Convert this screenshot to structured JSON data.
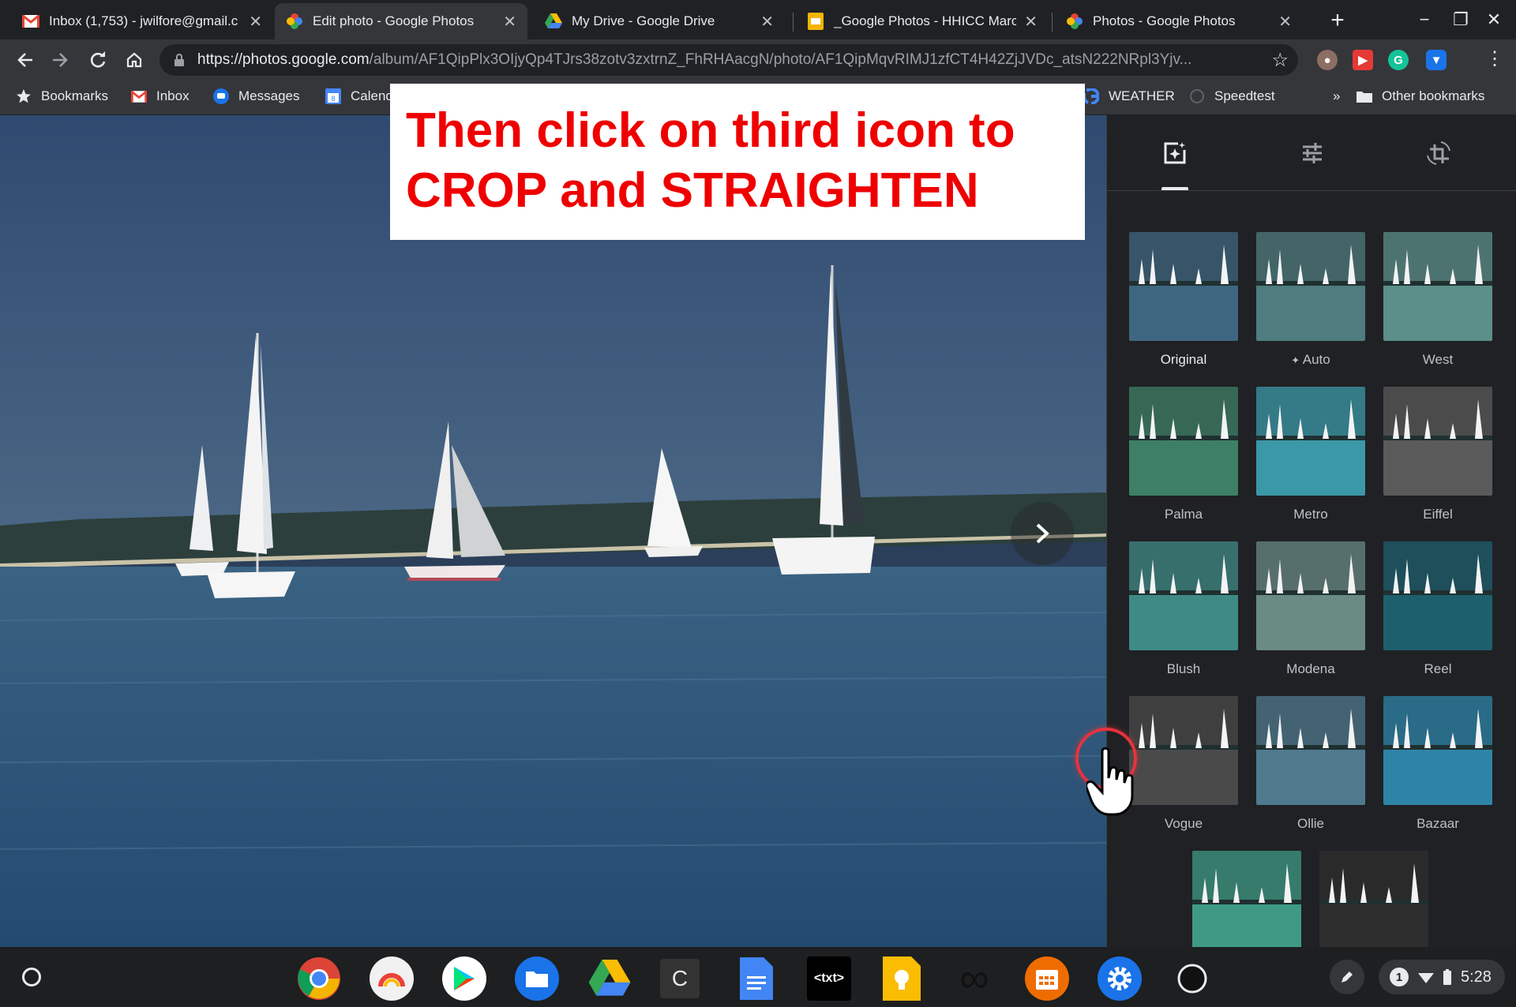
{
  "browser": {
    "tabs": [
      {
        "title": "Inbox (1,753) - jwilfore@gmail.c",
        "icon": "gmail-icon",
        "active": false
      },
      {
        "title": "Edit photo - Google Photos",
        "icon": "google-photos-icon",
        "active": true
      },
      {
        "title": "My Drive - Google Drive",
        "icon": "google-drive-icon",
        "active": false
      },
      {
        "title": "_Google Photos - HHICC March",
        "icon": "google-slides-icon",
        "active": false
      },
      {
        "title": "Photos - Google Photos",
        "icon": "google-photos-icon",
        "active": false
      }
    ],
    "url_host": "https://photos.google.com",
    "url_path": "/album/AF1QipPlx3OIjyQp4TJrs38zotv3zxtrnZ_FhRHAacgN/photo/AF1QipMqvRIMJ1zfCT4H42ZjJVDc_atsN222NRpl3Yjv...",
    "bookmarks": [
      {
        "label": "Bookmarks",
        "icon": "star-icon"
      },
      {
        "label": "Inbox",
        "icon": "gmail-icon"
      },
      {
        "label": "Messages",
        "icon": "messages-icon"
      },
      {
        "label": "Calend",
        "icon": "calendar-icon"
      },
      {
        "label": "WEATHER",
        "icon": "google-icon"
      },
      {
        "label": "Speedtest",
        "icon": "speedtest-icon"
      },
      {
        "label": "»",
        "icon": ""
      },
      {
        "label": "Other bookmarks",
        "icon": "folder-icon"
      }
    ]
  },
  "annotation": {
    "line1": "Then click on third icon to",
    "line2": "CROP and STRAIGHTEN"
  },
  "editor": {
    "tabs": [
      {
        "name": "filters",
        "icon": "photo-filter-icon",
        "active": true
      },
      {
        "name": "adjustments",
        "icon": "tune-sliders-icon",
        "active": false
      },
      {
        "name": "crop-rotate",
        "icon": "crop-rotate-icon",
        "active": false
      }
    ],
    "filters": [
      {
        "label": "Original",
        "selected": true,
        "tint": "#3f6680"
      },
      {
        "label": "Auto",
        "selected": false,
        "tint": "#4f7c7e"
      },
      {
        "label": "West",
        "selected": false,
        "tint": "#5c8f8a"
      },
      {
        "label": "Palma",
        "selected": false,
        "tint": "#3d8066"
      },
      {
        "label": "Metro",
        "selected": false,
        "tint": "#3b98a8"
      },
      {
        "label": "Eiffel",
        "selected": false,
        "tint": "#5a5a5a"
      },
      {
        "label": "Blush",
        "selected": false,
        "tint": "#3f8a84"
      },
      {
        "label": "Modena",
        "selected": false,
        "tint": "#6a8a84"
      },
      {
        "label": "Reel",
        "selected": false,
        "tint": "#1e5f6e"
      },
      {
        "label": "Vogue",
        "selected": false,
        "tint": "#4a4a4a"
      },
      {
        "label": "Ollie",
        "selected": false,
        "tint": "#4f7a8e"
      },
      {
        "label": "Bazaar",
        "selected": false,
        "tint": "#2d84a8"
      },
      {
        "label": "",
        "selected": false,
        "tint": "#3e9a84"
      },
      {
        "label": "",
        "selected": false,
        "tint": "#2e2e2e"
      }
    ]
  },
  "shelf": {
    "apps": [
      "chrome-icon",
      "chrome-canvas-icon",
      "play-store-icon",
      "files-icon",
      "google-drive-icon",
      "caret-editor-icon",
      "google-docs-icon",
      "text-editor-icon",
      "google-keep-icon",
      "infinity-icon",
      "calendar-app-icon",
      "settings-icon",
      "circle-app-icon"
    ],
    "text_editor_label": "<txt>",
    "caret_label": "C",
    "notification_count": "1",
    "time": "5:28"
  },
  "colors": {
    "sky": "#3d5a80",
    "water": "#2f5578",
    "annotation_text": "#ef0000",
    "cursor_ring": "#e8323c"
  }
}
